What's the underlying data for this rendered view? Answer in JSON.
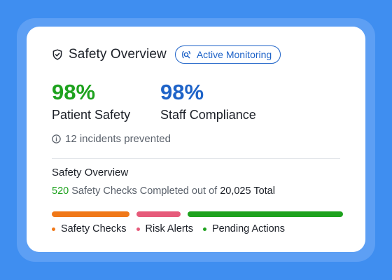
{
  "header": {
    "title": "Safety Overview",
    "badge_label": "Active Monitoring",
    "shield_icon": "shield-icon",
    "monitor_icon": "monitoring-icon"
  },
  "stats": [
    {
      "value": "98%",
      "label": "Patient Safety",
      "color": "#1ea21e"
    },
    {
      "value": "98%",
      "label": "Staff Compliance",
      "color": "#1e63c8"
    }
  ],
  "incidents": {
    "icon": "info-icon",
    "text": "12 incidents prevented"
  },
  "overview": {
    "title": "Safety Overview",
    "completed": "520",
    "middle_text": " Safety Checks Completed out of ",
    "total": "20,025 Total"
  },
  "progress": [
    {
      "name": "Safety Checks",
      "color": "#f07818",
      "fraction": 0.28
    },
    {
      "name": "Risk Alerts",
      "color": "#e65a7a",
      "fraction": 0.16
    },
    {
      "name": "Pending Actions",
      "color": "#1ea21e",
      "fraction": 0.56
    }
  ],
  "colors": {
    "accent_blue": "#1e63c8",
    "green": "#1ea21e",
    "background": "#3f8ef0"
  }
}
